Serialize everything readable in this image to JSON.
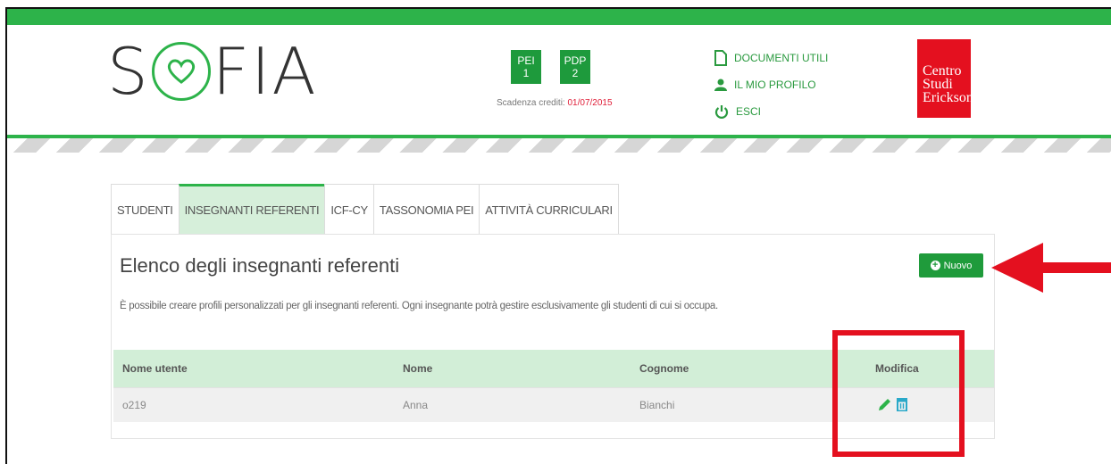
{
  "header": {
    "logo_text_left": "S",
    "logo_text_right": "FIA",
    "badges": [
      {
        "label": "PEI",
        "count": "1"
      },
      {
        "label": "PDP",
        "count": "2"
      }
    ],
    "deadline_label": "Scadenza crediti:",
    "deadline_date": "01/07/2015",
    "links": [
      {
        "label": "DOCUMENTI UTILI",
        "icon": "document-icon"
      },
      {
        "label": "IL MIO PROFILO",
        "icon": "user-icon"
      },
      {
        "label": "ESCI",
        "icon": "power-icon"
      }
    ],
    "brand": {
      "line1": "Centro",
      "line2": "Studi",
      "line3": "Erickson"
    }
  },
  "tabs": [
    "STUDENTI",
    "INSEGNANTI REFERENTI",
    "ICF-CY",
    "TASSONOMIA PEI",
    "ATTIVITÀ CURRICULARI"
  ],
  "active_tab": "INSEGNANTI REFERENTI",
  "panel": {
    "title": "Elenco degli insegnanti referenti",
    "description": "È possibile creare profili personalizzati per gli insegnanti referenti. Ogni insegnante potrà gestire esclusivamente gli studenti di cui si occupa.",
    "new_button": "Nuovo"
  },
  "table": {
    "headers": [
      "Nome utente",
      "Nome",
      "Cognome",
      "Modifica"
    ],
    "rows": [
      {
        "username": "o219",
        "nome": "Anna",
        "cognome": "Bianchi"
      }
    ]
  },
  "colors": {
    "accent": "#2db34a",
    "highlight": "#e4101f",
    "header_row": "#d2eed7"
  }
}
